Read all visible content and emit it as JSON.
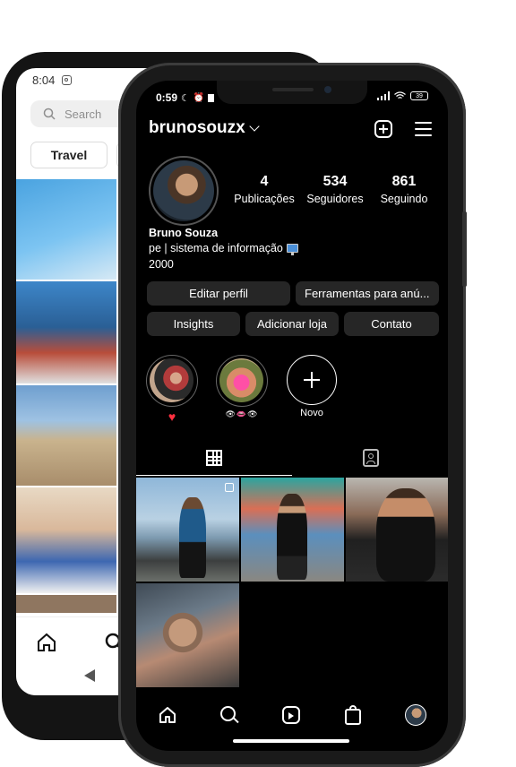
{
  "back_phone": {
    "time": "8:04",
    "search_placeholder": "Search",
    "tab_label": "Travel"
  },
  "front_phone": {
    "status": {
      "time": "0:59",
      "battery": "39"
    },
    "profile": {
      "username": "brunosouzx",
      "stats": [
        {
          "value": "4",
          "label": "Publicações"
        },
        {
          "value": "534",
          "label": "Seguidores"
        },
        {
          "value": "861",
          "label": "Seguindo"
        }
      ],
      "name": "Bruno Souza",
      "bio_line1": "pe | sistema de informação",
      "bio_line2": "2000"
    },
    "buttons": {
      "edit_profile": "Editar perfil",
      "tools": "Ferramentas para anú...",
      "insights": "Insights",
      "add_shop": "Adicionar loja",
      "contact": "Contato"
    },
    "highlights": [
      {
        "label": "♥"
      },
      {
        "label": "👁👄👁"
      },
      {
        "label": "Novo"
      }
    ]
  },
  "colors": {
    "screen_bg": "#000000",
    "button_bg": "#262626",
    "heart": "#ff3040"
  }
}
